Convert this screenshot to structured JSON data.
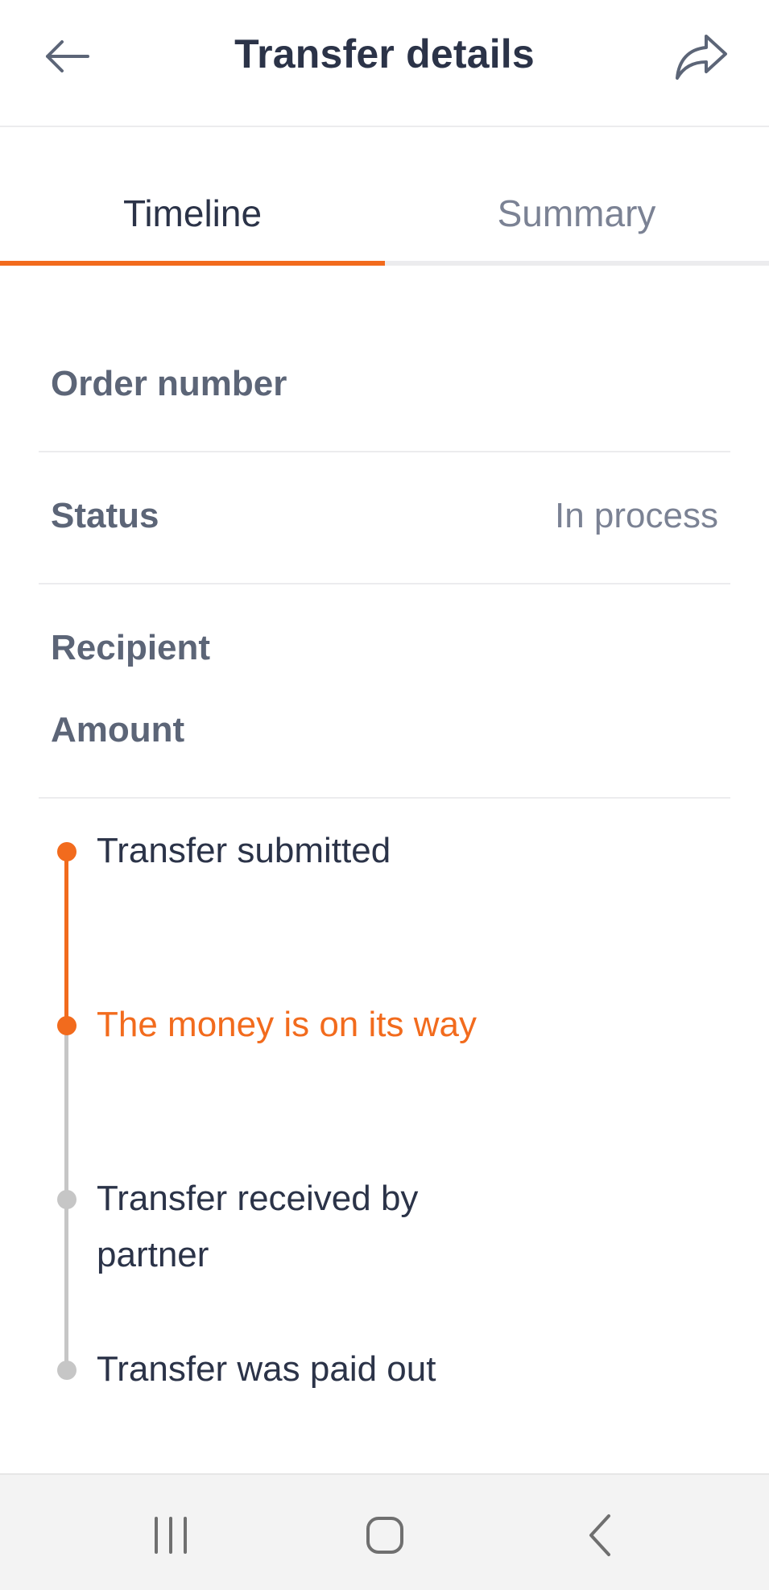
{
  "header": {
    "title": "Transfer details"
  },
  "tabs": [
    {
      "label": "Timeline",
      "active": true
    },
    {
      "label": "Summary",
      "active": false
    }
  ],
  "details": {
    "order_number_label": "Order number",
    "order_number_value": "",
    "status_label": "Status",
    "status_value": "In process",
    "recipient_label": "Recipient",
    "amount_label": "Amount"
  },
  "timeline": {
    "steps": [
      {
        "text": "Transfer submitted",
        "state": "done"
      },
      {
        "text": "The money is on its way",
        "state": "current"
      },
      {
        "text": "Transfer received by partner",
        "state": "pending"
      },
      {
        "text": "Transfer was paid out",
        "state": "pending"
      }
    ]
  },
  "icons": {
    "back": "arrow-left-icon",
    "share": "share-arrow-icon",
    "recent_apps": "recent-apps-icon",
    "home": "home-icon",
    "system_back": "chevron-left-icon"
  },
  "colors": {
    "accent": "#f26b1d",
    "text": "#2b3348",
    "muted": "#7b8294",
    "inactive_step": "#c6c6c6"
  }
}
